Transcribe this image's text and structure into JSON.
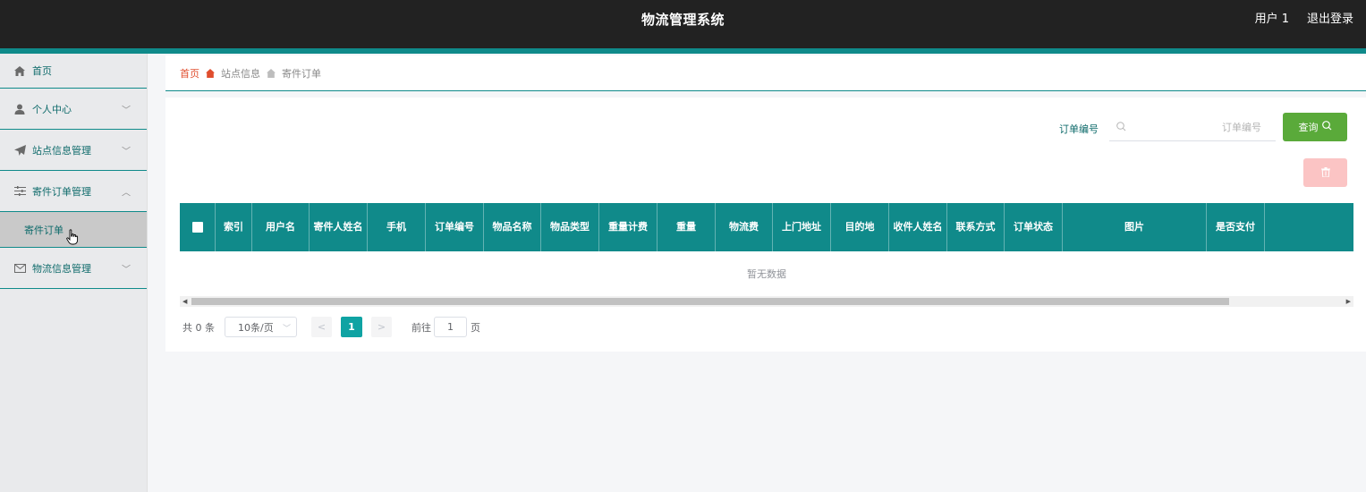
{
  "header": {
    "title": "物流管理系统",
    "user_label": "用户 1",
    "logout_label": "退出登录"
  },
  "sidebar": {
    "items": [
      {
        "label": "首页",
        "icon": "home-icon"
      },
      {
        "label": "个人中心",
        "icon": "user-icon"
      },
      {
        "label": "站点信息管理",
        "icon": "paper-plane-icon"
      },
      {
        "label": "寄件订单管理",
        "icon": "sliders-icon"
      },
      {
        "label": "物流信息管理",
        "icon": "envelope-icon"
      }
    ],
    "subitem": {
      "label": "寄件订单"
    }
  },
  "breadcrumb": {
    "home": "首页",
    "level1": "站点信息",
    "level2": "寄件订单"
  },
  "search": {
    "label": "订单编号",
    "placeholder": "订单编号",
    "value": "",
    "query_label": "查询"
  },
  "table": {
    "columns": [
      "索引",
      "用户名",
      "寄件人姓名",
      "手机",
      "订单编号",
      "物品名称",
      "物品类型",
      "重量计费",
      "重量",
      "物流费",
      "上门地址",
      "目的地",
      "收件人姓名",
      "联系方式",
      "订单状态",
      "图片",
      "是否支付",
      ""
    ],
    "empty_text": "暂无数据"
  },
  "pagination": {
    "total_text": "共 0 条",
    "page_size": "10条/页",
    "current_page": "1",
    "goto_label": "前往",
    "goto_value": "1",
    "page_suffix": "页"
  },
  "colors": {
    "header_bg": "#222222",
    "accent": "#0f8a8a",
    "query_button": "#5aaa3a",
    "delete_button": "#fbc4c4",
    "breadcrumb_home": "#e04d2d"
  }
}
